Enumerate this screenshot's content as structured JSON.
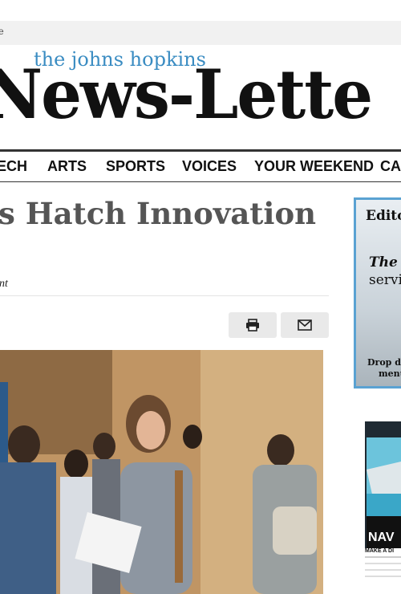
{
  "topbar": {
    "text": "e"
  },
  "masthead": {
    "subtitle": "the johns hopkins",
    "title": "News-Lette"
  },
  "nav": {
    "items": [
      "ECH",
      "ARTS",
      "SPORTS",
      "VOICES",
      "YOUR WEEKEND",
      "CA"
    ]
  },
  "article": {
    "headline": "s Hatch Innovation",
    "section": "nt",
    "actions": {
      "print_icon": "printer-icon",
      "email_icon": "envelope-icon"
    }
  },
  "sidebar": {
    "ad1": {
      "line1": "Edito",
      "line2": "The N",
      "line3": "servi",
      "line4": "Drop do",
      "line5": "menu"
    },
    "ad2": {
      "brand": "NAV",
      "tagline": "MAKE A DI"
    }
  },
  "colors": {
    "accent": "#3a8cc2",
    "ad_border": "#5aa2d2",
    "nav_rule": "#333333"
  }
}
